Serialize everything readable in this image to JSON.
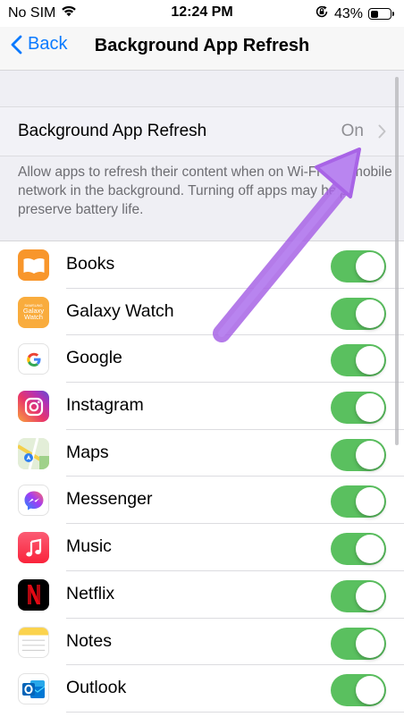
{
  "status_bar": {
    "carrier": "No SIM",
    "time": "12:24 PM",
    "battery": "43%",
    "battery_level": 0.43,
    "icons": [
      "wifi-icon",
      "orientation-lock-icon",
      "battery-icon"
    ]
  },
  "nav": {
    "back_label": "Back",
    "title": "Background App Refresh"
  },
  "refresh_setting": {
    "label": "Background App Refresh",
    "value": "On",
    "footer": "Allow apps to refresh their content when on Wi-Fi or a mobile network in the background. Turning off apps may help preserve battery life."
  },
  "apps": [
    {
      "name": "Books",
      "icon": "books-icon",
      "enabled": true
    },
    {
      "name": "Galaxy Watch",
      "icon": "galaxy-watch-icon",
      "enabled": true
    },
    {
      "name": "Google",
      "icon": "google-icon",
      "enabled": true
    },
    {
      "name": "Instagram",
      "icon": "instagram-icon",
      "enabled": true
    },
    {
      "name": "Maps",
      "icon": "maps-icon",
      "enabled": true
    },
    {
      "name": "Messenger",
      "icon": "messenger-icon",
      "enabled": true
    },
    {
      "name": "Music",
      "icon": "music-icon",
      "enabled": true
    },
    {
      "name": "Netflix",
      "icon": "netflix-icon",
      "enabled": true
    },
    {
      "name": "Notes",
      "icon": "notes-icon",
      "enabled": true
    },
    {
      "name": "Outlook",
      "icon": "outlook-icon",
      "enabled": true
    }
  ],
  "galaxy_watch_icon_text": [
    "SAMSUNG",
    "Galaxy",
    "Watch"
  ],
  "colors": {
    "accent": "#0a7aff",
    "toggle_on": "#5ac05f",
    "arrow": "#b67ee8"
  }
}
